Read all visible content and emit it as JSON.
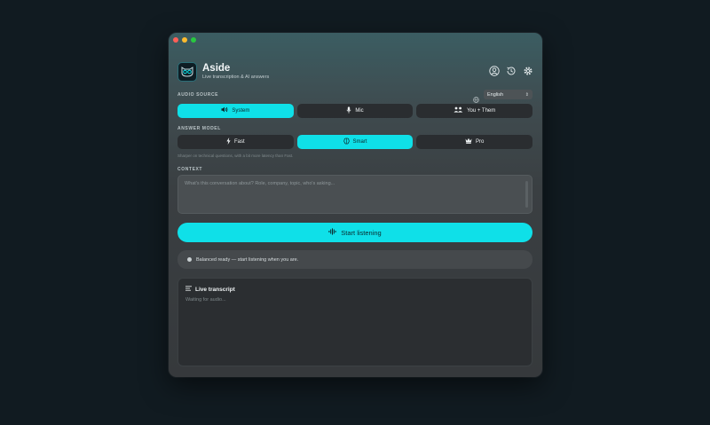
{
  "app": {
    "title": "Aside",
    "subtitle": "Live transcription & AI answers"
  },
  "header_icons": [
    "user-circle-icon",
    "history-icon",
    "gear-icon"
  ],
  "audio_source": {
    "label": "AUDIO SOURCE",
    "language": "English",
    "options": [
      {
        "label": "System",
        "icon": "speaker-icon",
        "active": true
      },
      {
        "label": "Mic",
        "icon": "microphone-icon",
        "active": false
      },
      {
        "label": "You + Them",
        "icon": "people-icon",
        "active": false
      }
    ]
  },
  "answer_model": {
    "label": "ANSWER MODEL",
    "options": [
      {
        "label": "Fast",
        "icon": "bolt-icon",
        "active": false
      },
      {
        "label": "Smart",
        "icon": "brain-icon",
        "active": true
      },
      {
        "label": "Pro",
        "icon": "crown-icon",
        "active": false
      }
    ],
    "hint": "Sharper on technical questions, with a bit more latency than Fast."
  },
  "context": {
    "label": "CONTEXT",
    "placeholder": "What's this conversation about? Role, company, topic, who's asking..."
  },
  "start_button": {
    "label": "Start listening",
    "icon": "waveform-icon"
  },
  "status": {
    "text": "Balanced ready — start listening when you are."
  },
  "transcript": {
    "title": "Live transcript",
    "placeholder": "Waiting for audio..."
  },
  "colors": {
    "accent": "#0fe0e8",
    "background": "#111b21",
    "window": "#36393c"
  }
}
